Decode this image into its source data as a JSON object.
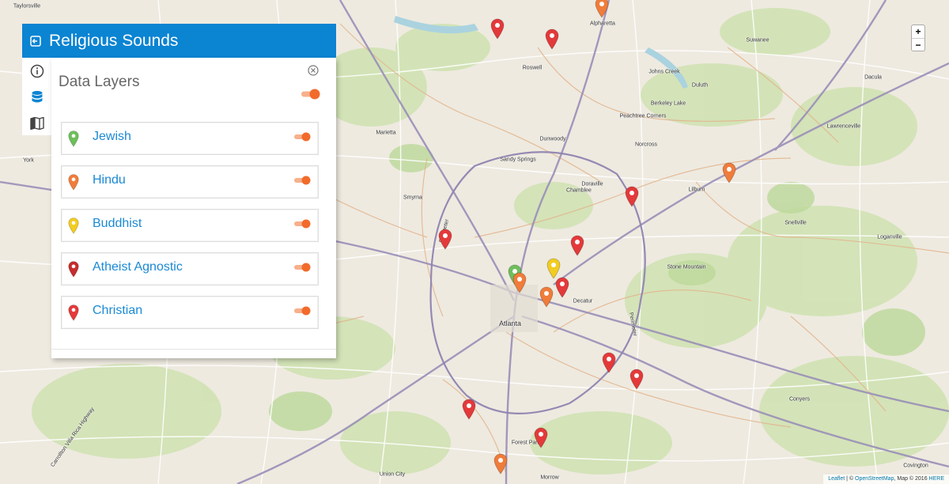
{
  "sidebar": {
    "title": "Religious Sounds",
    "tabs": [
      {
        "icon": "info-icon"
      },
      {
        "icon": "database-icon"
      },
      {
        "icon": "map-icon"
      }
    ],
    "pane": {
      "title": "Data Layers",
      "layers": [
        {
          "label": "Jewish",
          "color": "#6dbf5b"
        },
        {
          "label": "Hindu",
          "color": "#f07c3a"
        },
        {
          "label": "Buddhist",
          "color": "#f2cc1f"
        },
        {
          "label": "Atheist Agnostic",
          "color": "#c62c2c"
        },
        {
          "label": "Christian",
          "color": "#e4393a"
        }
      ]
    }
  },
  "zoom": {
    "in": "+",
    "out": "−"
  },
  "attribution": {
    "leaflet": "Leaflet",
    "sep": " | © ",
    "osm": "OpenStreetMap",
    "middle": ", Map © 2016 ",
    "here": "HERE"
  },
  "colors": {
    "accent": "#0b84d2",
    "toggle": "#f26b2b",
    "link": "#1a8ad4"
  },
  "map": {
    "places": [
      "Taylorsville",
      "Alpharetta",
      "Roswell",
      "Suwanee",
      "Johns Creek",
      "Duluth",
      "Berkeley Lake",
      "Peachtree Corners",
      "Dacula",
      "Lawrenceville",
      "Marietta",
      "Dunwoody",
      "Norcross",
      "Sandy Springs",
      "Doraville",
      "Chamblee",
      "Lilburn",
      "Smyrna",
      "Snellville",
      "Loganville",
      "Stone Mountain",
      "Decatur",
      "Atlanta",
      "Conyers",
      "Forest Park",
      "Union City",
      "Morrow",
      "Covington",
      "York",
      "Perimeter",
      "Carrollton Villa Rica Highway"
    ]
  },
  "markers": [
    {
      "type": "Christian",
      "color": "#e4393a"
    },
    {
      "type": "Christian",
      "color": "#e4393a"
    },
    {
      "type": "Hindu",
      "color": "#f07c3a"
    },
    {
      "type": "Hindu",
      "color": "#f07c3a"
    },
    {
      "type": "Christian",
      "color": "#e4393a"
    },
    {
      "type": "Christian",
      "color": "#e4393a"
    },
    {
      "type": "Christian",
      "color": "#e4393a"
    },
    {
      "type": "Jewish",
      "color": "#6dbf5b"
    },
    {
      "type": "Buddhist",
      "color": "#f2cc1f"
    },
    {
      "type": "Hindu",
      "color": "#f07c3a"
    },
    {
      "type": "Christian",
      "color": "#e4393a"
    },
    {
      "type": "Hindu",
      "color": "#f07c3a"
    },
    {
      "type": "Christian",
      "color": "#e4393a"
    },
    {
      "type": "Christian",
      "color": "#e4393a"
    },
    {
      "type": "Christian",
      "color": "#e4393a"
    },
    {
      "type": "Christian",
      "color": "#e4393a"
    },
    {
      "type": "Hindu",
      "color": "#f07c3a"
    }
  ]
}
